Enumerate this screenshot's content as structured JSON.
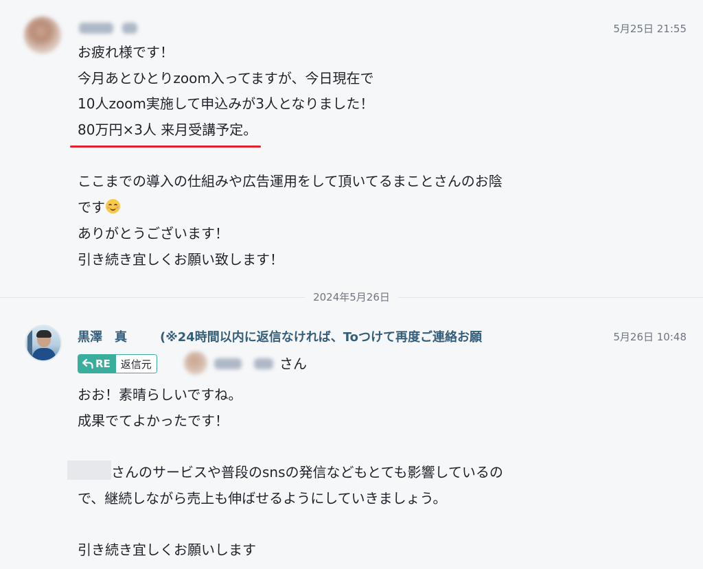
{
  "messages": [
    {
      "timestamp": "5月25日 21:55",
      "lines": [
        "お疲れ様です！",
        "今月あとひとりzoom入ってますが、今日現在で",
        "10人zoom実施して申込みが3人となりました！",
        "80万円×3人 来月受講予定。",
        "",
        "ここまでの導入の仕組みや広告運用をして頂いてるまことさんのお陰",
        "です",
        "ありがとうございます！",
        "引き続き宜しくお願い致します！"
      ],
      "highlighted_line_index": 3,
      "emoji_after_line_index": 6,
      "emoji": "smiling-face-emoji"
    },
    {
      "sender": "黒澤　真",
      "sender_note": "(※24時間以内に返信なければ、Toつけて再度ご連絡お願",
      "timestamp": "5月26日 10:48",
      "reply": {
        "re_label": "RE",
        "source_label": "返信元",
        "suffix": "さん"
      },
      "lines": [
        "おお！素晴らしいですね。",
        "成果でてよかったです！",
        "",
        "さんのサービスや普段のsnsの発信などもとても影響しているの",
        "で、継続しながら売上も伸ばせるようにしていきましょう。",
        "",
        "引き続き宜しくお願いします"
      ]
    }
  ],
  "date_divider": "2024年5月26日",
  "colors": {
    "background": "#f6f7f9",
    "sender_name": "#355e7a",
    "re_chip": "#3aae9d",
    "highlight_underline": "#e0212d",
    "timestamp": "#6f7680"
  },
  "icons": {
    "reply_arrow": "reply-arrow-icon"
  }
}
